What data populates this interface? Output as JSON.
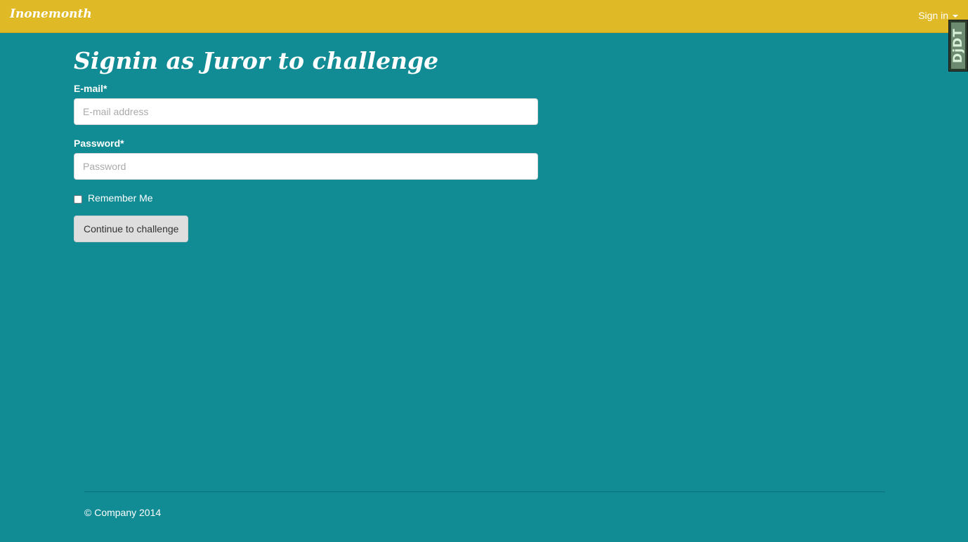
{
  "navbar": {
    "brand": "Inonemonth",
    "signin_label": "Sign in",
    "background_color": "#e0b926"
  },
  "debug_toolbar": {
    "label": "DjDT"
  },
  "page": {
    "title": "Signin as Juror to challenge",
    "background_color": "#118b94"
  },
  "form": {
    "email_label": "E-mail*",
    "email_placeholder": "E-mail address",
    "email_value": "",
    "password_label": "Password*",
    "password_placeholder": "Password",
    "password_value": "",
    "remember_label": "Remember Me",
    "remember_checked": false,
    "submit_label": "Continue to challenge"
  },
  "footer": {
    "text": "© Company 2014"
  }
}
